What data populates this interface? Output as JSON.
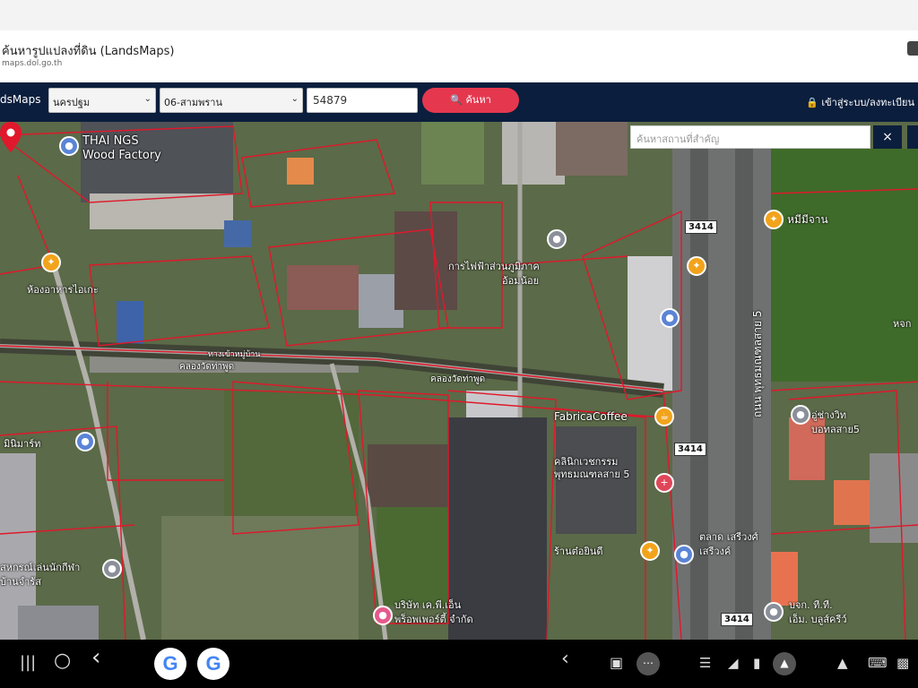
{
  "browser": {
    "title": "ค้นหารูปแปลงที่ดิน (LandsMaps)",
    "url": "maps.dol.go.th"
  },
  "navbar": {
    "brand": "dsMaps",
    "province": "นครปฐม",
    "district": "06-สามพราน",
    "parcel_value": "54879",
    "search_label": "ค้นหา",
    "login_label": "เข้าสู่ระบบ/ลงทะเบียน"
  },
  "map": {
    "search_placeholder": "ค้นหาสถานที่สำคัญ",
    "clear_label": "×",
    "labels": {
      "factory_l1": "THAI NGS",
      "factory_l2": "Wood Factory",
      "restaurant_left": "ห้องอาหารไอเกะ",
      "canal_1": "คลองวัดท่าพูด",
      "canal_2": "คลองวัดท่าพูด",
      "electric": "การไฟฟ้าส่วนภูมิภาค",
      "electric_2": "อ้อมน้อย",
      "restaurant_right": "หมีมีจาน",
      "highway_name": "ถนน พุทธมณฑลสาย 5",
      "fabrica": "FabricaCoffee",
      "clinic_l1": "คลินิกเวชกรรม",
      "clinic_l2": "พุทธมณฑลสาย 5",
      "shop": "ร้านต๋อยินดี",
      "market_l1": "ตลาด เสรีวงศ์",
      "market_l2": "เสรีวงค์",
      "company_l1": "บริษัท เค.พี.เอ็น",
      "company_l2": "พร็อพเพอร์ตี้ จำกัด",
      "mini_mart": "มินิมาร์ท",
      "bottom_left": "สหกรณ์เล่นนักกีฬา",
      "bottom_left_2": "บ้านจำรัส",
      "garage_l1": "อู่ช่างวิท",
      "garage_l2": "บอทลสาย5",
      "tmb_l1": "บจก. ที.ที.",
      "tmb_l2": "เอ็ม. บลูส์ครีว์",
      "edge_right": "หจก",
      "parcel_label": "ทางเข้าหมู่บ้าน"
    },
    "shields": [
      "3414",
      "3414",
      "3414"
    ]
  },
  "system": {
    "recent_icon": "|||",
    "home_icon": "○",
    "back_icon": "‹",
    "google_letter": "G"
  },
  "colors": {
    "navbar_bg": "#0b1e3d",
    "search_btn": "#e5384f",
    "parcel_line": "#e0182b"
  }
}
